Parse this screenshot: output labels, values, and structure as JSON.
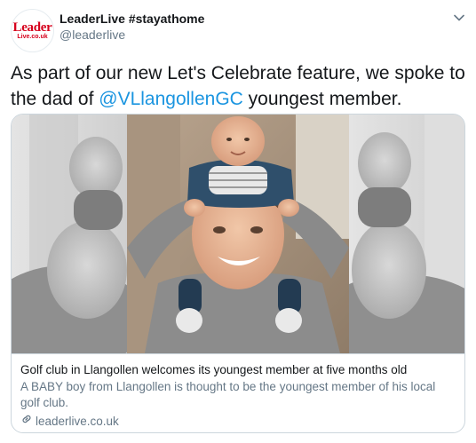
{
  "author": {
    "display_name": "LeaderLive #stayathome",
    "handle": "@leaderlive",
    "avatar_logo_top": "Leader",
    "avatar_logo_bottom": "Live.co.uk"
  },
  "tweet": {
    "text_before": "As part of our new Let's Celebrate feature, we spoke to the dad of ",
    "mention": "@VLlangollenGC",
    "text_after": " youngest member."
  },
  "card": {
    "image_icon": "photo-father-with-baby-on-shoulders",
    "title": "Golf club in Llangollen welcomes its youngest member at five months old",
    "description": "A BABY boy from Llangollen is thought to be the youngest member of his local golf club.",
    "domain": "leaderlive.co.uk",
    "domain_icon": "link-icon"
  },
  "colors": {
    "link": "#1b95e0",
    "text": "#14171a",
    "secondary": "#657786",
    "border": "#ccd6dd",
    "brand": "#d6001c"
  }
}
